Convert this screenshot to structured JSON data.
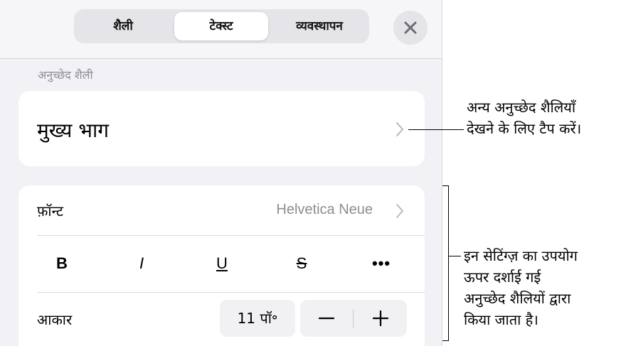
{
  "tabs": [
    {
      "label": "शैली",
      "selected": false
    },
    {
      "label": "टेक्स्ट",
      "selected": true
    },
    {
      "label": "व्यवस्थापन",
      "selected": false
    }
  ],
  "close_icon": "x-close-icon",
  "paragraph_style": {
    "section_label": "अनुच्छेद शैली",
    "current_style": "मुख्य भाग"
  },
  "font_row": {
    "label": "फ़ॉन्ट",
    "value": "Helvetica Neue"
  },
  "format_buttons": {
    "bold": "B",
    "italic": "I",
    "underline": "U",
    "strikethrough": "S",
    "more": "•••"
  },
  "size_row": {
    "label": "आकार",
    "value": "11 पॉ॰"
  },
  "callouts": {
    "style_callout": [
      "अन्य अनुच्छेद शैलियाँ",
      "देखने के लिए टैप करें।"
    ],
    "settings_callout": [
      "इन सेटिंग्ज़ का उपयोग",
      "ऊपर दर्शाई गई",
      "अनुच्छेद शैलियों द्वारा",
      "किया जाता है।"
    ]
  },
  "colors": {
    "panel_bg": "#f1f1f6",
    "card_bg": "#ffffff",
    "secondary_text": "#8e8e93",
    "chevron": "#b8b8be"
  }
}
